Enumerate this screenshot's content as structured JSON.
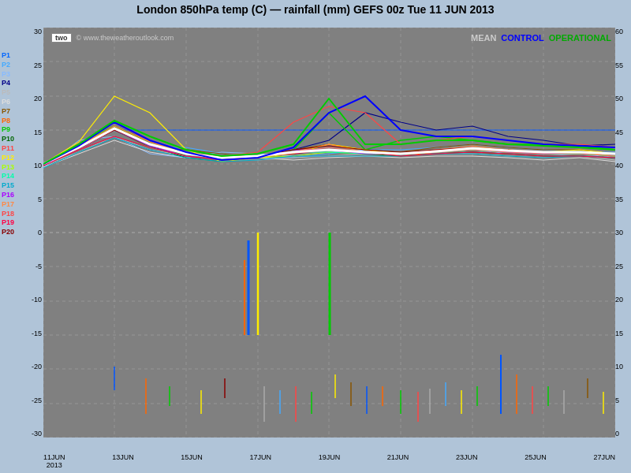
{
  "title": "London 850hPa temp (C) — rainfall (mm)   GEFS 00z Tue 11 JUN 2013",
  "watermark": "© www.theweatheroutlook.com",
  "twoLabel": "two",
  "legend": {
    "mean": "MEAN",
    "control": "CONTROL",
    "operational": "OPERATIONAL"
  },
  "colors": {
    "background": "#808080",
    "title_bg": "#b0c4d8",
    "mean": "#ffffff",
    "control": "#0000ff",
    "operational": "#00aa00"
  },
  "yAxis": {
    "left": [
      "30",
      "25",
      "20",
      "15",
      "10",
      "5",
      "0",
      "-5",
      "-10",
      "-15",
      "-20",
      "-25",
      "-30"
    ],
    "right": [
      "60",
      "55",
      "50",
      "45",
      "40",
      "35",
      "30",
      "25",
      "20",
      "15",
      "10",
      "5",
      "0"
    ]
  },
  "xAxis": [
    "11JUN\n2013",
    "13JUN",
    "15JUN",
    "17JUN",
    "19JUN",
    "21JUN",
    "23JUN",
    "25JUN",
    "27JUN"
  ],
  "legendItems": [
    {
      "label": "P1",
      "color": "#0000ff"
    },
    {
      "label": "P2",
      "color": "#00aaff"
    },
    {
      "label": "P3",
      "color": "#88bbff"
    },
    {
      "label": "P4",
      "color": "#000077"
    },
    {
      "label": "P5",
      "color": "#aaaaaa"
    },
    {
      "label": "P6",
      "color": "#dddddd"
    },
    {
      "label": "P7",
      "color": "#884400"
    },
    {
      "label": "P8",
      "color": "#ff6600"
    },
    {
      "label": "P9",
      "color": "#00cc00"
    },
    {
      "label": "P10",
      "color": "#006600"
    },
    {
      "label": "P11",
      "color": "#ff0000"
    },
    {
      "label": "P12",
      "color": "#ffff00"
    },
    {
      "label": "P13",
      "color": "#aaff00"
    },
    {
      "label": "P14",
      "color": "#00ffaa"
    },
    {
      "label": "P15",
      "color": "#00aaaa"
    },
    {
      "label": "P16",
      "color": "#aa00ff"
    },
    {
      "label": "P17",
      "color": "#ff88aa"
    },
    {
      "label": "P18",
      "color": "#ff4444"
    },
    {
      "label": "P19",
      "color": "#ff0044"
    },
    {
      "label": "P20",
      "color": "#880000"
    }
  ]
}
